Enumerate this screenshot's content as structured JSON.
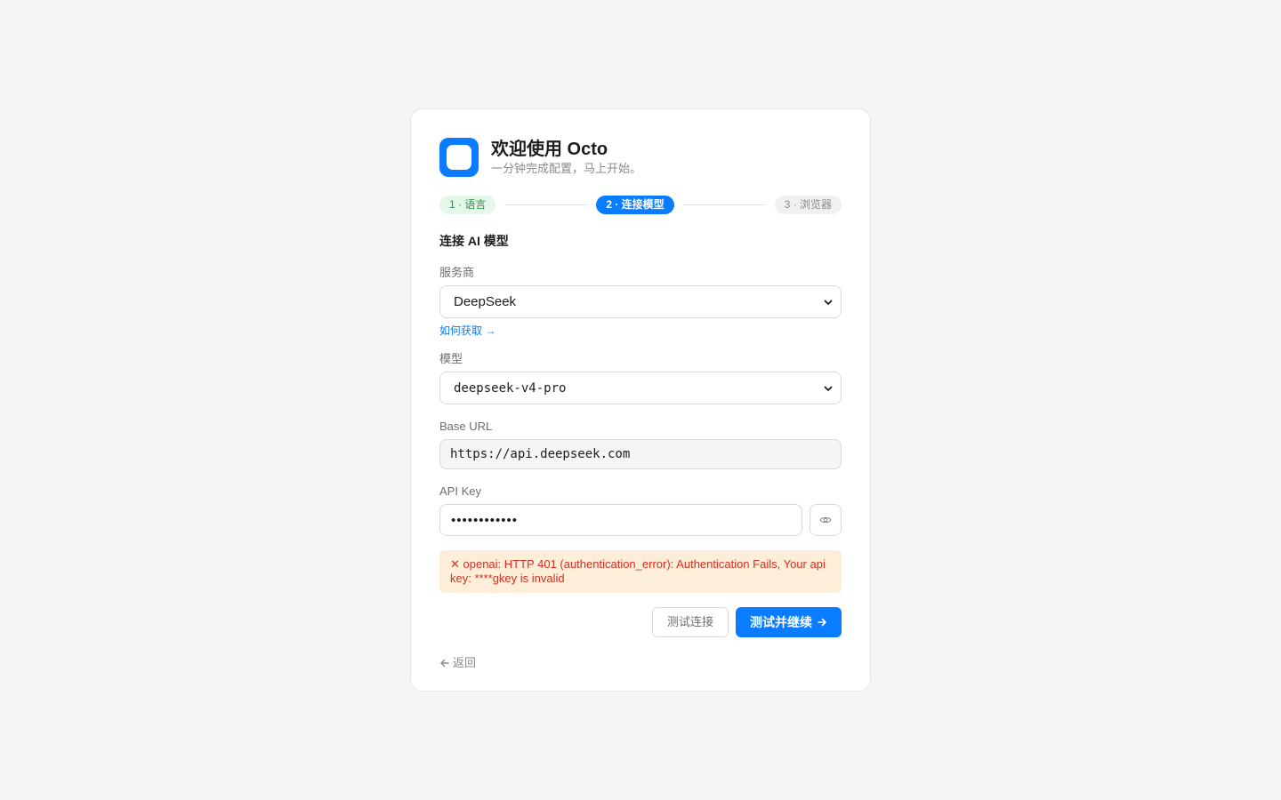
{
  "header": {
    "title": "欢迎使用 Octo",
    "subtitle": "一分钟完成配置，马上开始。",
    "logo_icon": "app-logo-icon"
  },
  "steps": [
    {
      "label": "1 · 语言",
      "state": "done"
    },
    {
      "label": "2 · 连接模型",
      "state": "active"
    },
    {
      "label": "3 · 浏览器",
      "state": "todo"
    }
  ],
  "section_title": "连接 AI 模型",
  "provider": {
    "label": "服务商",
    "value": "DeepSeek",
    "help_link": "如何获取 →"
  },
  "model": {
    "label": "模型",
    "value": "deepseek-v4-pro"
  },
  "base_url": {
    "label": "Base URL",
    "value": "https://api.deepseek.com"
  },
  "api_key": {
    "label": "API Key",
    "masked_value": "••••••••••••",
    "toggle_icon": "eye-icon"
  },
  "error": {
    "message": "✕ openai: HTTP 401 (authentication_error): Authentication Fails, Your api key: ****gkey is invalid"
  },
  "actions": {
    "test_label": "测试连接",
    "continue_label": "测试并继续"
  },
  "back_label": "返回",
  "colors": {
    "accent": "#0a7cff",
    "success_bg": "#e5f6ea",
    "success_text": "#2e8b47",
    "error_bg": "#fdeed9",
    "error_text": "#d92d20"
  }
}
